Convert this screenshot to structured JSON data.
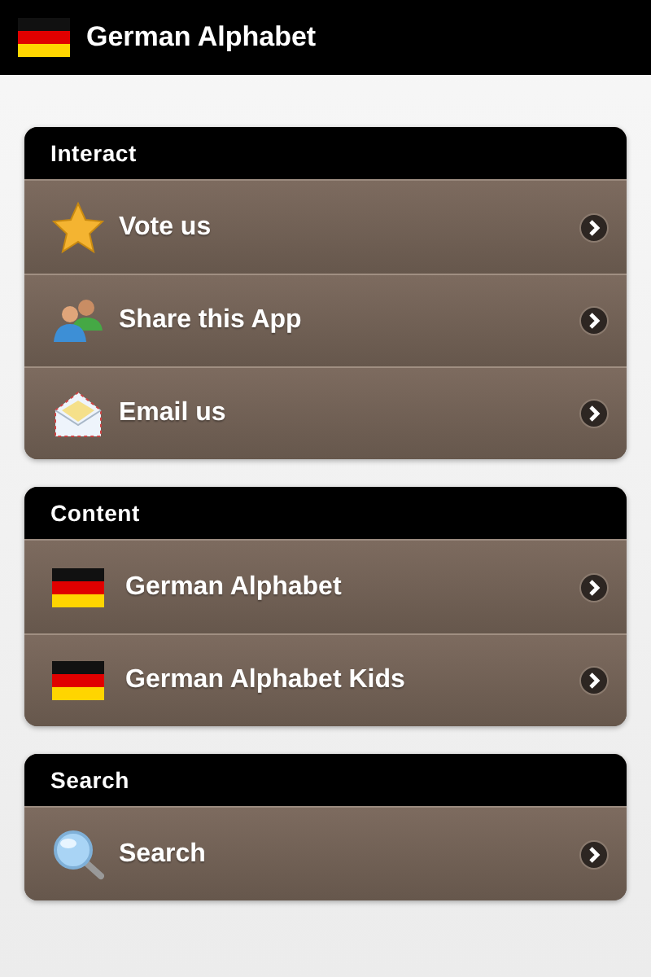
{
  "app_bar": {
    "title": "German Alphabet"
  },
  "sections": [
    {
      "title": "Interact",
      "items": [
        {
          "label": "Vote us",
          "kind": "star"
        },
        {
          "label": "Share this App",
          "kind": "people"
        },
        {
          "label": "Email us",
          "kind": "envelope"
        }
      ]
    },
    {
      "title": "Content",
      "items": [
        {
          "label": "German Alphabet",
          "kind": "flag"
        },
        {
          "label": "German Alphabet Kids",
          "kind": "flag"
        }
      ]
    },
    {
      "title": "Search",
      "items": [
        {
          "label": "Search",
          "kind": "search"
        }
      ]
    }
  ]
}
